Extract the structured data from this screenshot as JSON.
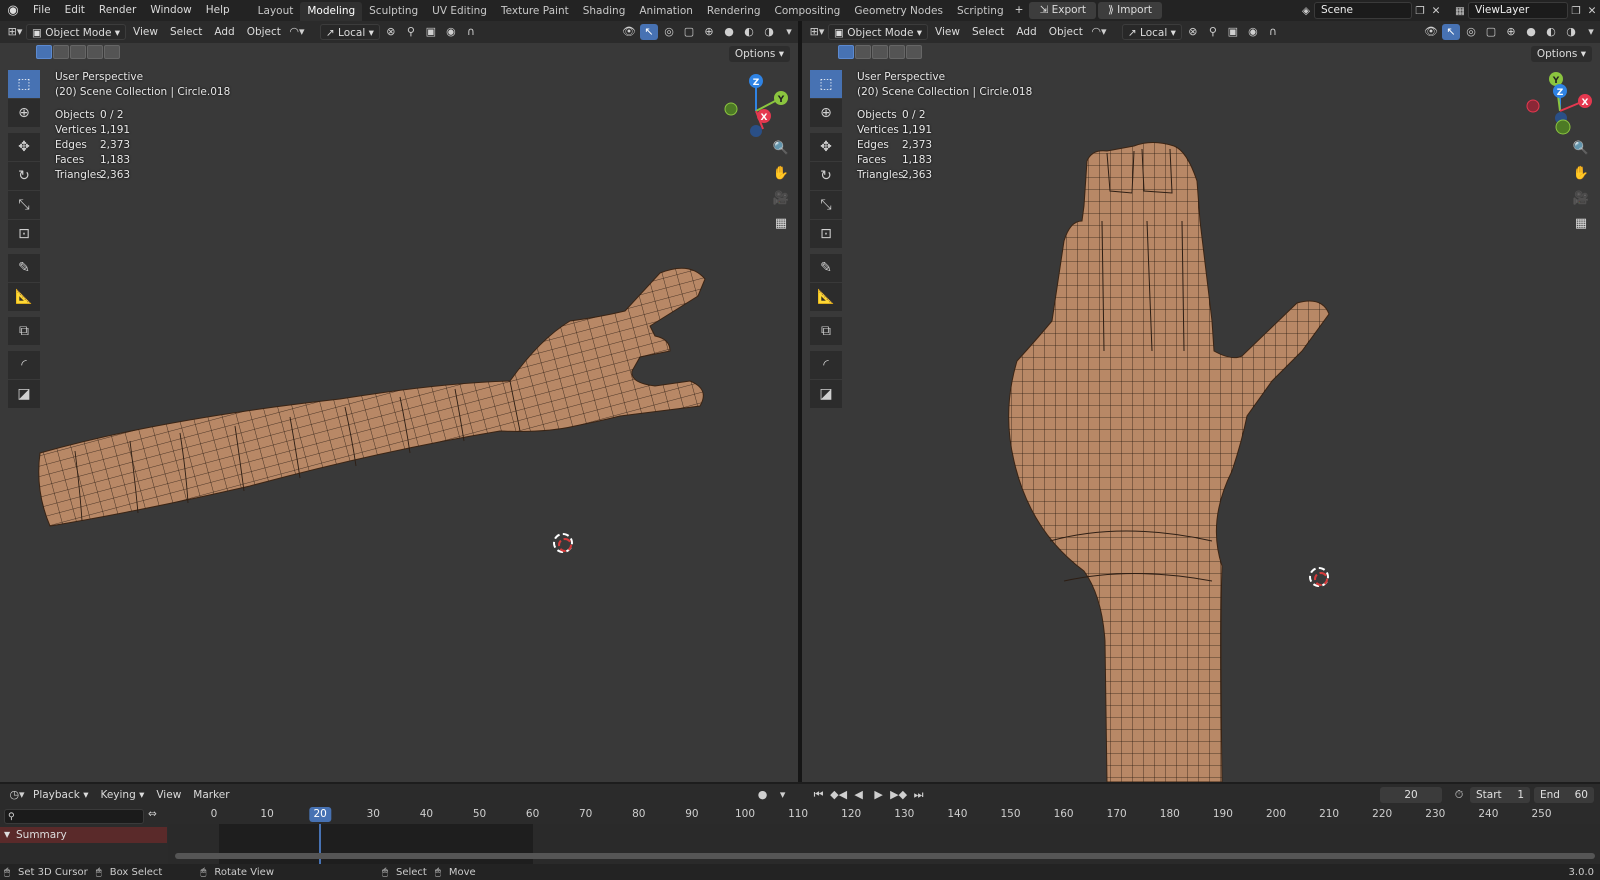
{
  "topbar": {
    "menus": [
      "File",
      "Edit",
      "Render",
      "Window",
      "Help"
    ],
    "workspace_tabs": [
      {
        "label": "Layout"
      },
      {
        "label": "Modeling",
        "active": true
      },
      {
        "label": "Sculpting"
      },
      {
        "label": "UV Editing"
      },
      {
        "label": "Texture Paint"
      },
      {
        "label": "Shading"
      },
      {
        "label": "Animation"
      },
      {
        "label": "Rendering"
      },
      {
        "label": "Compositing"
      },
      {
        "label": "Geometry Nodes"
      },
      {
        "label": "Scripting"
      }
    ],
    "add_tab": "+",
    "export_label": "Export",
    "import_label": "Import",
    "scene_name": "Scene",
    "view_layer": "ViewLayer"
  },
  "viewports": [
    {
      "header": {
        "mode": "Object Mode",
        "menus": [
          "View",
          "Select",
          "Add",
          "Object"
        ],
        "orientation": "Local",
        "options_label": "Options"
      },
      "info": {
        "perspective": "User Perspective",
        "collection": "(20) Scene Collection | Circle.018"
      },
      "stats": [
        {
          "label": "Objects",
          "value": "0 / 2"
        },
        {
          "label": "Vertices",
          "value": "1,191"
        },
        {
          "label": "Edges",
          "value": "2,373"
        },
        {
          "label": "Faces",
          "value": "1,183"
        },
        {
          "label": "Triangles",
          "value": "2,363"
        }
      ],
      "gizmo": {
        "x": "X",
        "y": "Y",
        "z": "Z"
      }
    },
    {
      "header": {
        "mode": "Object Mode",
        "menus": [
          "View",
          "Select",
          "Add",
          "Object"
        ],
        "orientation": "Local",
        "options_label": "Options"
      },
      "info": {
        "perspective": "User Perspective",
        "collection": "(20) Scene Collection | Circle.018"
      },
      "stats": [
        {
          "label": "Objects",
          "value": "0 / 2"
        },
        {
          "label": "Vertices",
          "value": "1,191"
        },
        {
          "label": "Edges",
          "value": "2,373"
        },
        {
          "label": "Faces",
          "value": "1,183"
        },
        {
          "label": "Triangles",
          "value": "2,363"
        }
      ],
      "gizmo": {
        "x": "X",
        "y": "Y",
        "z": "Z"
      }
    }
  ],
  "timeline": {
    "menus": [
      "Playback",
      "Keying",
      "View",
      "Marker"
    ],
    "current_frame": "20",
    "start_label": "Start",
    "start_value": "1",
    "end_label": "End",
    "end_value": "60",
    "summary_label": "Summary",
    "ticks": [
      "0",
      "10",
      "20",
      "30",
      "40",
      "50",
      "60",
      "70",
      "80",
      "90",
      "100",
      "110",
      "120",
      "130",
      "140",
      "150",
      "160",
      "170",
      "180",
      "190",
      "200",
      "210",
      "220",
      "230",
      "240",
      "250"
    ],
    "current_frame_marker": "20"
  },
  "statusbar": {
    "items": [
      "Set 3D Cursor",
      "Box Select",
      "Rotate View",
      "Select",
      "Move"
    ],
    "version": "3.0.0"
  },
  "colors": {
    "accent": "#4772b3",
    "axis_x": "#e5384f",
    "axis_y": "#8bc53f",
    "axis_z": "#2f83e4",
    "skin": "#b88866"
  },
  "icons": {
    "tools": [
      "select-box-icon",
      "cursor-icon",
      "move-icon",
      "rotate-icon",
      "scale-icon",
      "transform-icon",
      "annotate-icon",
      "measure-icon",
      "add-cube-icon",
      "bevel-icon",
      "extrude-icon"
    ],
    "nav": [
      "zoom-icon",
      "pan-hand-icon",
      "camera-icon",
      "grid-icon"
    ]
  }
}
